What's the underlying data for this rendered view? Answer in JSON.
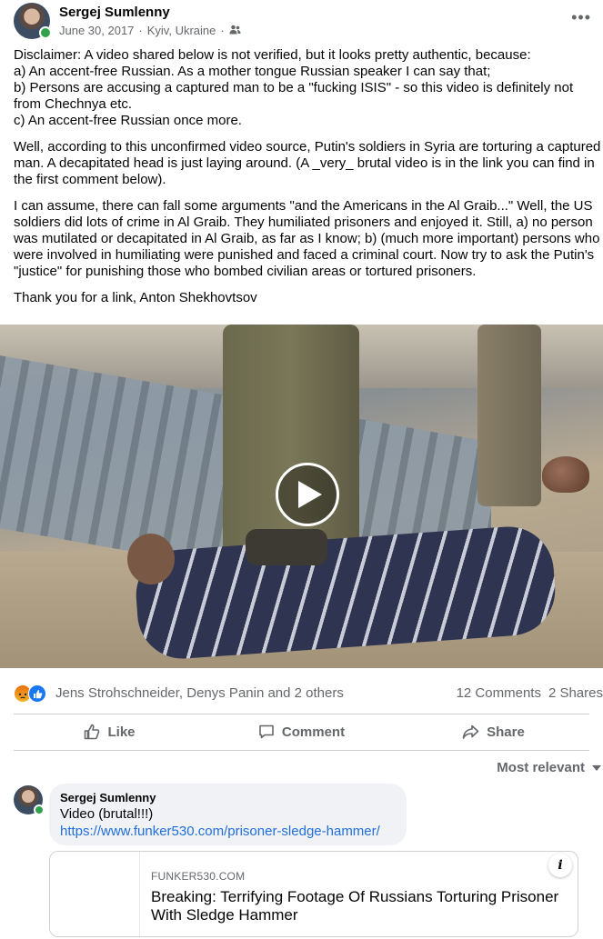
{
  "post": {
    "author": "Sergej Sumlenny",
    "date": "June 30, 2017",
    "location": "Kyiv, Ukraine",
    "separator": "·",
    "audience_icon": "friends-icon",
    "more_icon": "more-dots-icon",
    "paragraphs": [
      "Disclaimer: A video shared below is not verified, but it looks pretty authentic, because:\na) An accent-free Russian. As a mother tongue Russian speaker I can say that;\nb) Persons are accusing a captured man to be a \"fucking ISIS\" - so this video is definitely not from Chechnya etc.\nc) An accent-free Russian once more.",
      "Well, according to this unconfirmed video source, Putin's soldiers in Syria are torturing a captured man. A decapitated head is just laying around. (A _very_ brutal video is in the link you can find in the first comment below).",
      "I can assume, there can fall some arguments \"and the Americans in the Al Graib...\" Well, the US soldiers did lots of crime in Al Graib. They humiliated prisoners and enjoyed it. Still, a) no person was mutilated or decapitated in Al Graib, as far as I know; b) (much more important) persons who were involved in humiliating were punished and faced a criminal court. Now try to ask the Putin's \"justice\" for punishing those who bombed civilian areas or tortured prisoners.",
      "Thank you for a link, Anton Shekhovtsov"
    ]
  },
  "video": {
    "play_icon": "play-icon"
  },
  "reactions": {
    "icons": [
      "angry-icon",
      "like-icon"
    ],
    "names": "Jens Strohschneider, Denys Panin and 2 others",
    "comments_count": "12 Comments",
    "shares_count": "2 Shares"
  },
  "actions": {
    "like": "Like",
    "comment": "Comment",
    "share": "Share"
  },
  "comments": {
    "sort_label": "Most relevant",
    "first": {
      "author": "Sergej Sumlenny",
      "text": "Video (brutal!!!)",
      "link": "https://www.funker530.com/prisoner-sledge-hammer/"
    },
    "link_preview": {
      "domain": "FUNKER530.COM",
      "title": "Breaking: Terrifying Footage Of Russians Torturing Prisoner With Sledge Hammer",
      "info_label": "i"
    }
  },
  "colors": {
    "text": "#050505",
    "secondary": "#65676b",
    "link": "#216fdb",
    "online": "#31a24c",
    "like_blue": "#1877f2",
    "bubble_bg": "#f0f2f5"
  }
}
